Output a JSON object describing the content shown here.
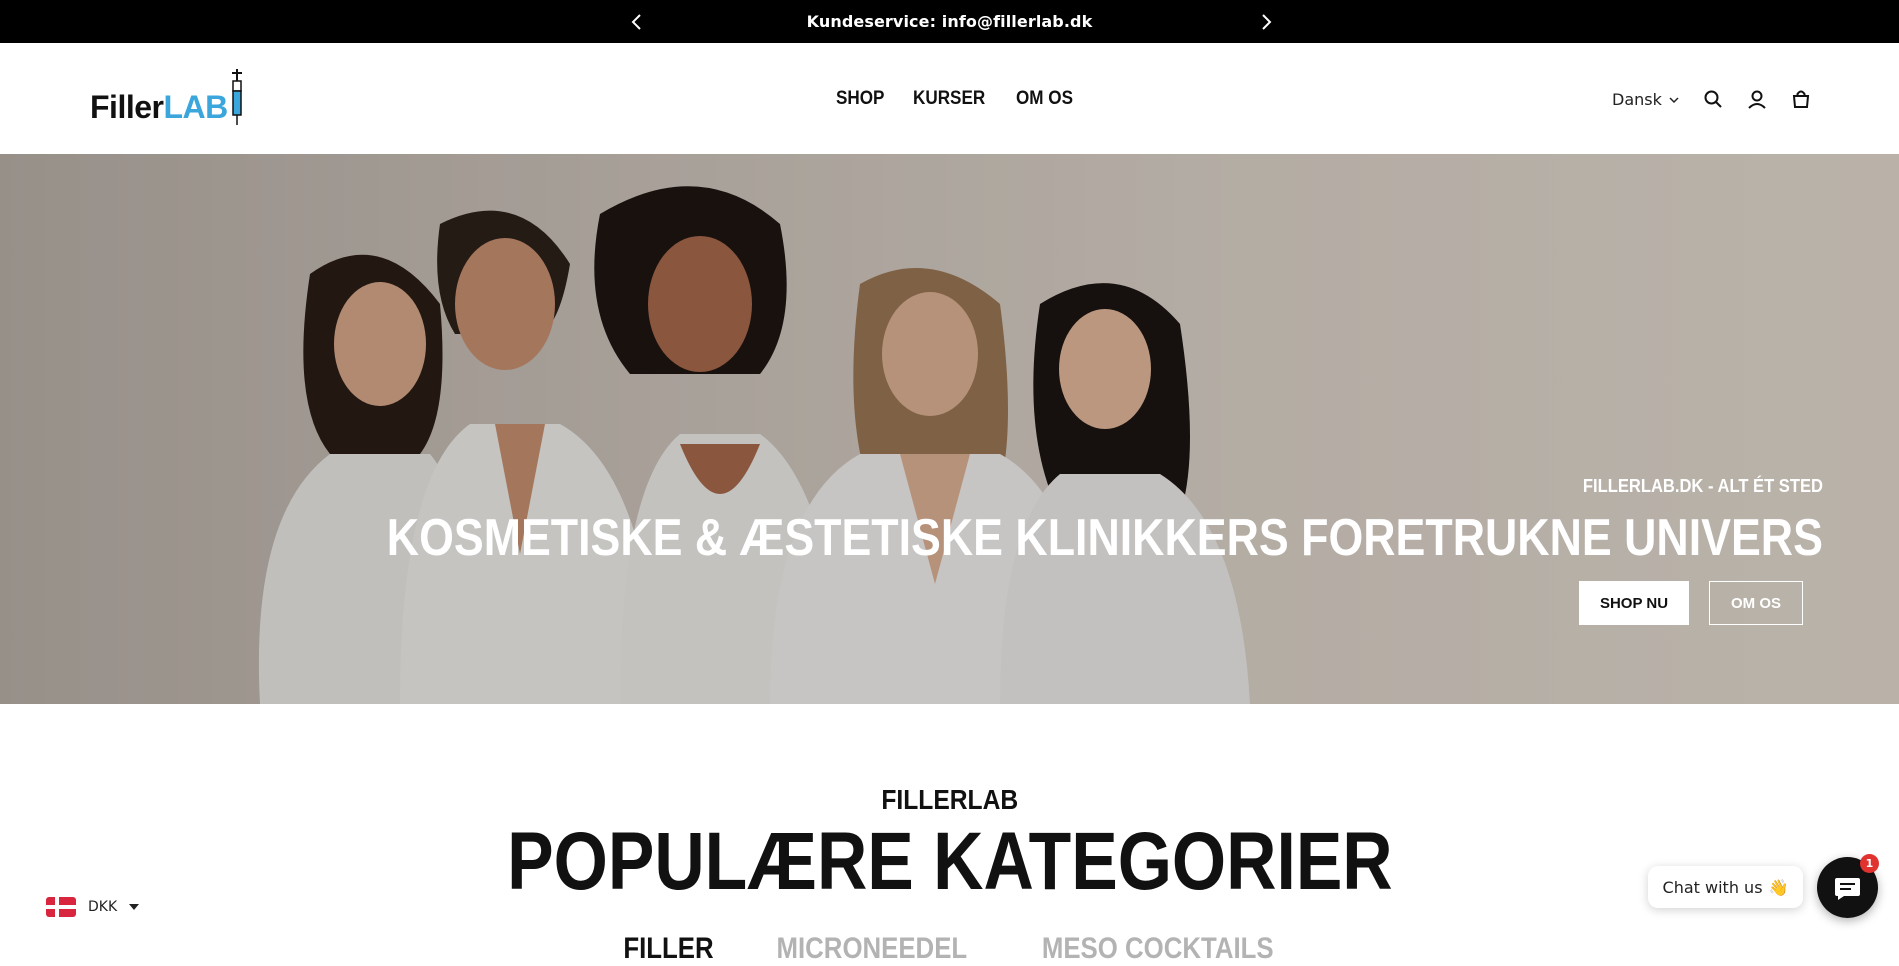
{
  "announcement": {
    "message": "Kundeservice: info@fillerlab.dk"
  },
  "header": {
    "logo_text_dark": "Filler",
    "logo_text_accent": "LAB",
    "nav": [
      {
        "label": "SHOP"
      },
      {
        "label": "KURSER"
      },
      {
        "label": "OM OS"
      }
    ],
    "language": "Dansk",
    "icons": [
      "search-icon",
      "account-icon",
      "cart-icon"
    ]
  },
  "hero": {
    "subtitle": "FILLERLAB.DK - ALT ÉT STED",
    "title": "KOSMETISKE & ÆSTETISKE KLINIKKERS FORETRUKNE UNIVERS",
    "primary_button": "SHOP NU",
    "secondary_button": "OM OS"
  },
  "categories": {
    "eyebrow": "FILLERLAB",
    "title": "POPULÆRE KATEGORIER",
    "tabs": [
      {
        "label": "FILLER",
        "active": true
      },
      {
        "label": "MICRONEEDEL",
        "active": false
      },
      {
        "label": "MESO COCKTAILS",
        "active": false
      }
    ]
  },
  "currency": {
    "code": "DKK",
    "flag": "denmark-flag-icon"
  },
  "chat": {
    "label": "Chat with us",
    "emoji": "👋",
    "badge_count": "1"
  },
  "colors": {
    "logo_accent": "#3aa6dc",
    "announcement_bg": "#000000",
    "tab_inactive": "#b3b3b3",
    "chat_badge": "#e0332f"
  }
}
